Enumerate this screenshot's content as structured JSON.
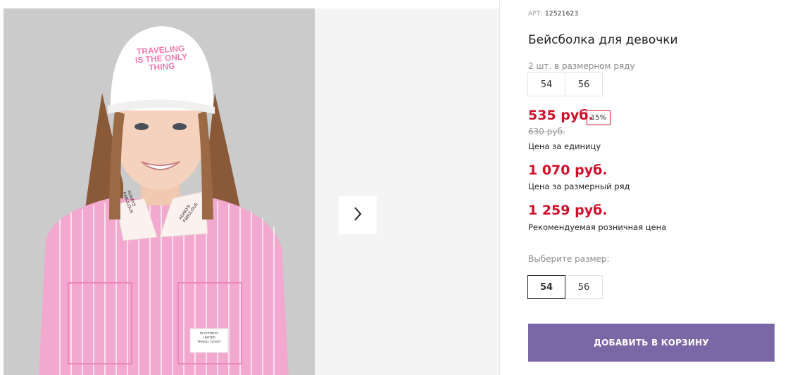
{
  "product": {
    "art_label": "АРТ:",
    "art_number": "12521623",
    "title": "Бейсболка для девочки",
    "range_label": "2 шт. в размерном ряду",
    "range_sizes": [
      "54",
      "56"
    ]
  },
  "photo": {
    "cap_text_line1": "TRAVELING",
    "cap_text_line2": "IS THE ONLY",
    "cap_text_line3": "THING",
    "collar_left": "ALWAYS FABULOUS",
    "collar_right": "ALWAYS FABULOUS",
    "tag_line1": "PLAYTODAY",
    "tag_line2": "LIMITED",
    "tag_line3": "TRAVEL TICKET"
  },
  "pricing": {
    "price": "535 руб.",
    "discount": "15%",
    "old_price": "630 руб.",
    "unit_caption": "Цена за единицу",
    "range_price": "1 070 руб.",
    "range_caption": "Цена за размерный ряд",
    "retail_price": "1 259 руб.",
    "retail_caption": "Рекомендуемая розничная цена"
  },
  "size_select": {
    "label": "Выберите размер:",
    "options": [
      "54",
      "56"
    ],
    "selected": "54"
  },
  "cart": {
    "add_label": "ДОБАВИТЬ В КОРЗИНУ"
  },
  "colors": {
    "accent_red": "#d0112b",
    "button_purple": "#7a68a6"
  }
}
